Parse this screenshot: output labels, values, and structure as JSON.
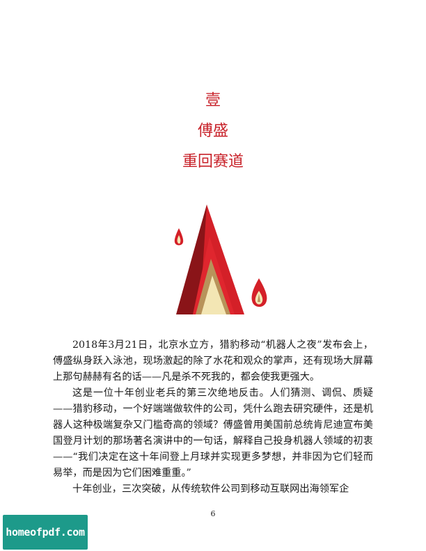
{
  "chapter": {
    "number": "壹",
    "author": "傅盛",
    "title": "重回赛道"
  },
  "paragraphs": [
    "2018年3月21日，北京水立方，猎豹移动“机器人之夜”发布会上，傅盛纵身跃入泳池，现场激起的除了水花和观众的掌声，还有现场大屏幕上那句赫赫有名的话——凡是杀不死我的，都会使我更强大。",
    "这是一位十年创业老兵的第三次绝地反击。人们猜测、调侃、质疑——猎豹移动，一个好端端做软件的公司，凭什么跑去研究硬件，还是机器人这种极端复杂又门槛奇高的领域？傅盛曾用美国前总统肯尼迪宣布美国登月计划的那场著名演讲中的一句话，解释自己投身机器人领域的初衷——“我们决定在这十年间登上月球并实现更多梦想，并非因为它们轻而易举，而是因为它们困难重重。”",
    "十年创业，三次突破，从传统软件公司到移动互联网出海领军企"
  ],
  "page_number": "6",
  "watermark": "homeofpdf.com",
  "colors": {
    "chapter_heading": "#c8222a",
    "flame_dark": "#8a1418",
    "flame_red": "#d42028",
    "flame_tan": "#b8935a",
    "flame_cream": "#f3e6b4",
    "watermark_bg": "#1d9a8a"
  }
}
